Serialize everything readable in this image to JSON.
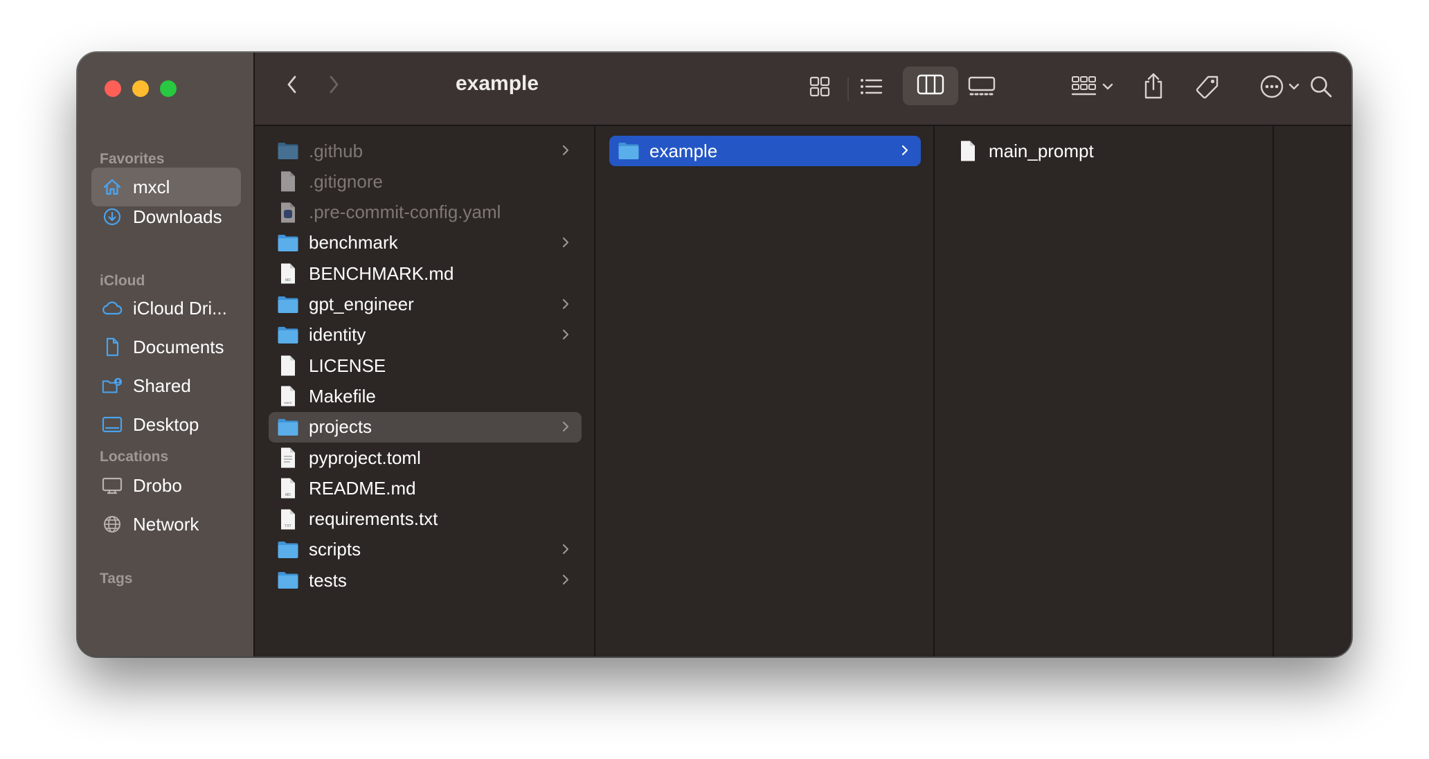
{
  "window": {
    "title": "example"
  },
  "sidebar": {
    "sections": [
      {
        "title": "Favorites",
        "items": [
          {
            "label": "mxcl",
            "icon": "home-icon",
            "selected": true
          },
          {
            "label": "Downloads",
            "icon": "downloads-icon"
          }
        ]
      },
      {
        "title": "iCloud",
        "items": [
          {
            "label": "iCloud Dri...",
            "icon": "icloud-icon"
          },
          {
            "label": "Documents",
            "icon": "document-icon"
          },
          {
            "label": "Shared",
            "icon": "shared-folder-icon"
          },
          {
            "label": "Desktop",
            "icon": "desktop-icon"
          }
        ]
      },
      {
        "title": "Locations",
        "items": [
          {
            "label": "Drobo",
            "icon": "drive-icon"
          },
          {
            "label": "Network",
            "icon": "globe-icon"
          }
        ]
      },
      {
        "title": "Tags",
        "items": []
      }
    ]
  },
  "toolbar": {
    "view_modes": [
      "icon-view",
      "list-view",
      "column-view",
      "gallery-view"
    ],
    "active_view": "column-view"
  },
  "columns": [
    {
      "items": [
        {
          "name": ".github",
          "type": "folder",
          "hidden": true,
          "has_children": true
        },
        {
          "name": ".gitignore",
          "type": "file",
          "hidden": true
        },
        {
          "name": ".pre-commit-config.yaml",
          "type": "yaml",
          "hidden": true
        },
        {
          "name": "benchmark",
          "type": "folder",
          "has_children": true
        },
        {
          "name": "BENCHMARK.md",
          "type": "md"
        },
        {
          "name": "gpt_engineer",
          "type": "folder",
          "has_children": true
        },
        {
          "name": "identity",
          "type": "folder",
          "has_children": true
        },
        {
          "name": "LICENSE",
          "type": "file"
        },
        {
          "name": "Makefile",
          "type": "make"
        },
        {
          "name": "projects",
          "type": "folder",
          "has_children": true,
          "selected": "inactive"
        },
        {
          "name": "pyproject.toml",
          "type": "text"
        },
        {
          "name": "README.md",
          "type": "md"
        },
        {
          "name": "requirements.txt",
          "type": "txt"
        },
        {
          "name": "scripts",
          "type": "folder",
          "has_children": true
        },
        {
          "name": "tests",
          "type": "folder",
          "has_children": true
        }
      ]
    },
    {
      "items": [
        {
          "name": "example",
          "type": "folder",
          "has_children": true,
          "selected": "active"
        }
      ]
    },
    {
      "items": [
        {
          "name": "main_prompt",
          "type": "file"
        }
      ]
    }
  ],
  "colors": {
    "selection_active": "#2457c5",
    "selection_inactive": "#4d4745",
    "folder": "#5aaeea",
    "sidebar_icon": "#4aa3ee"
  }
}
